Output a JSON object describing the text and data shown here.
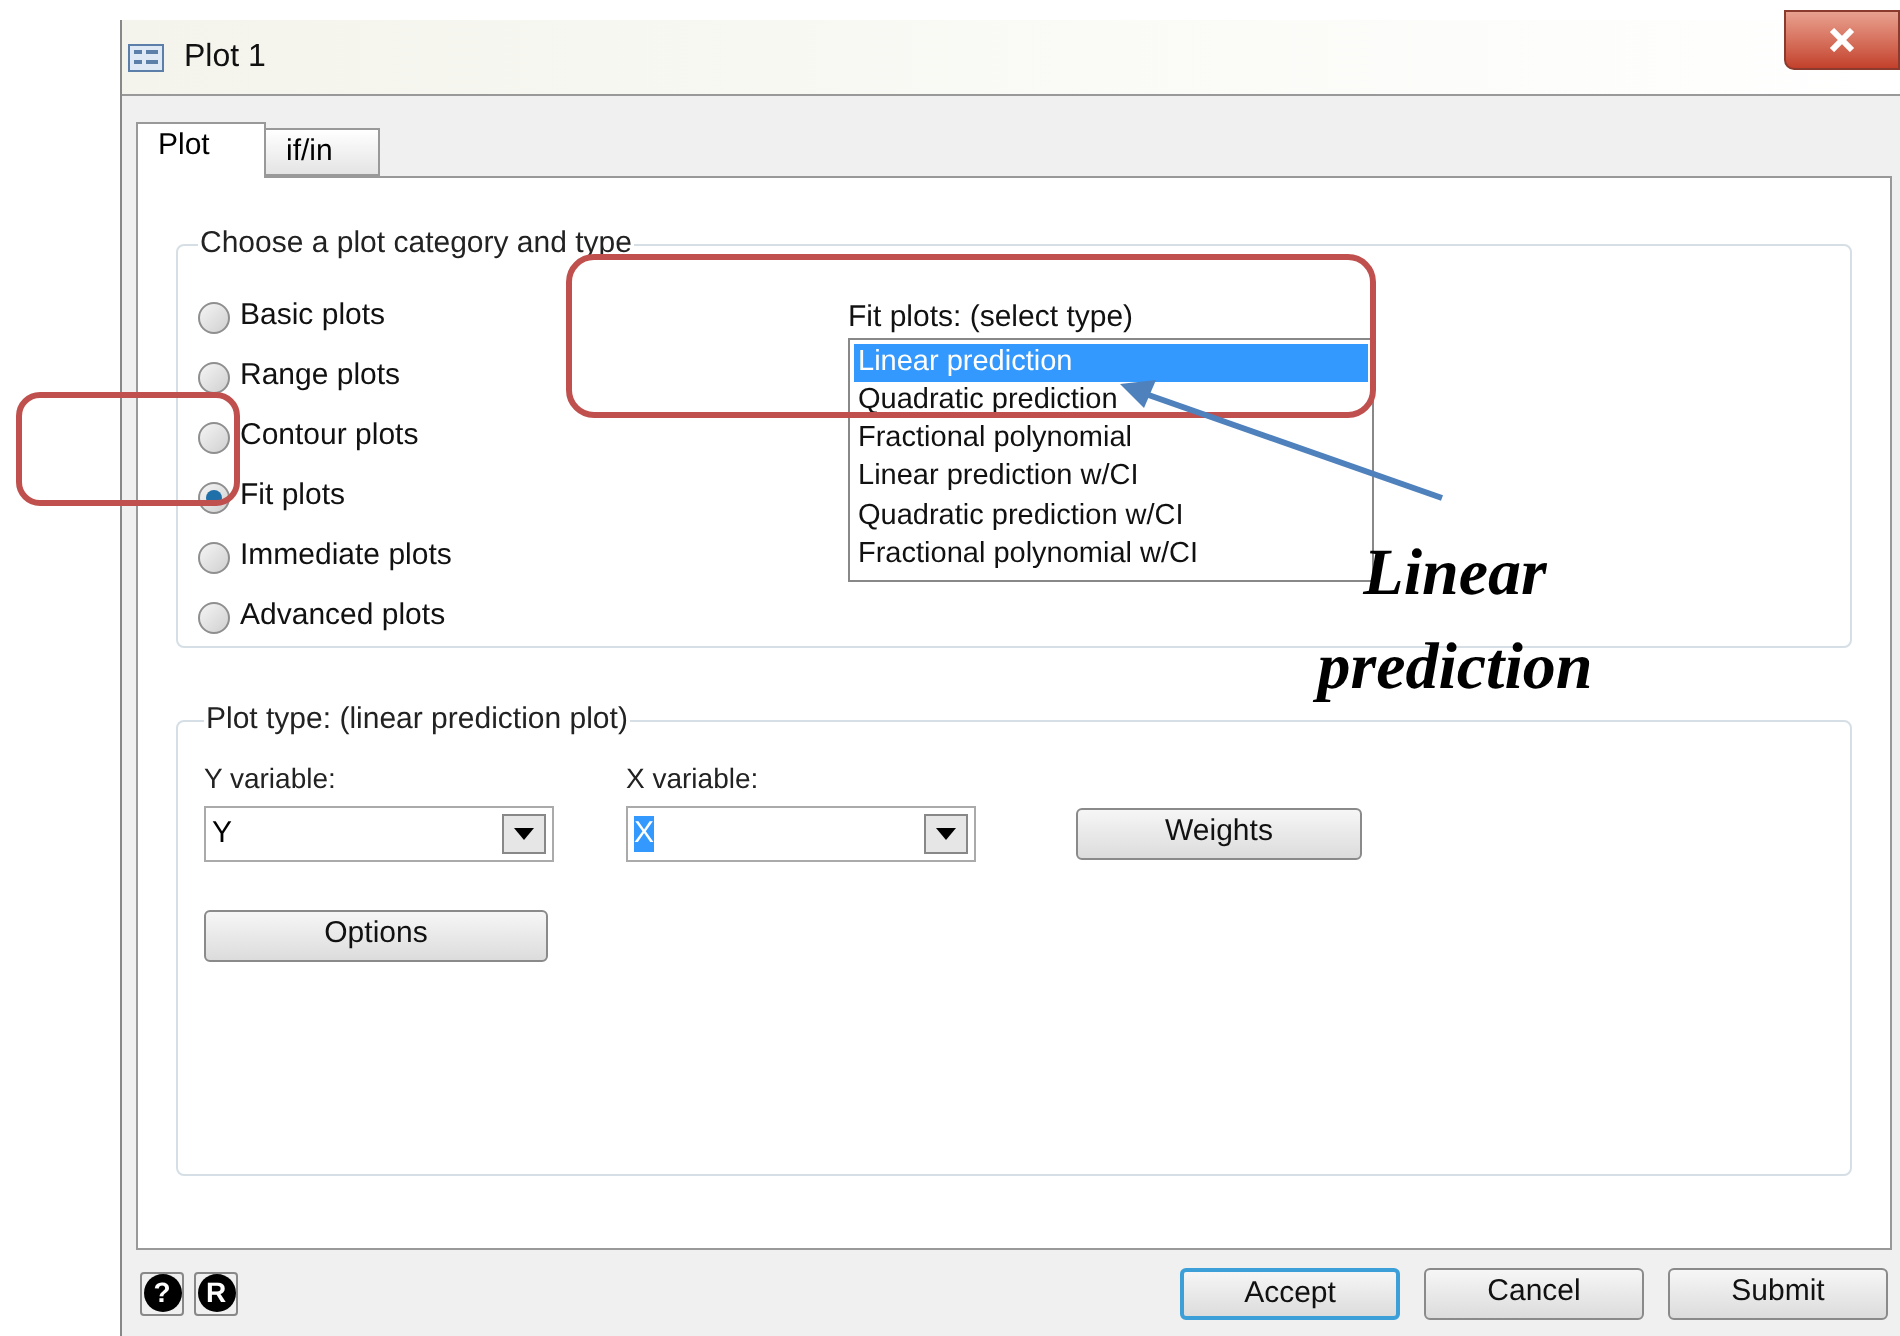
{
  "window": {
    "title": "Plot 1"
  },
  "tabs": [
    {
      "label": "Plot",
      "selected": true
    },
    {
      "label": "if/in",
      "selected": false
    }
  ],
  "category_group": {
    "title": "Choose a plot category and type",
    "options": [
      {
        "label": "Basic plots",
        "selected": false
      },
      {
        "label": "Range plots",
        "selected": false
      },
      {
        "label": "Contour plots",
        "selected": false
      },
      {
        "label": "Fit plots",
        "selected": true
      },
      {
        "label": "Immediate plots",
        "selected": false
      },
      {
        "label": "Advanced plots",
        "selected": false
      }
    ]
  },
  "fit_plots": {
    "label": "Fit plots: (select type)",
    "items": [
      {
        "label": "Linear prediction",
        "selected": true
      },
      {
        "label": "Quadratic prediction",
        "selected": false
      },
      {
        "label": "Fractional polynomial",
        "selected": false
      },
      {
        "label": "Linear prediction w/CI",
        "selected": false
      },
      {
        "label": "Quadratic prediction w/CI",
        "selected": false
      },
      {
        "label": "Fractional polynomial w/CI",
        "selected": false
      }
    ]
  },
  "plot_type_group": {
    "title": "Plot type: (linear prediction plot)",
    "y_variable": {
      "label": "Y variable:",
      "value": "Y",
      "highlighted": false
    },
    "x_variable": {
      "label": "X variable:",
      "value": "X",
      "highlighted": true
    },
    "weights_button": "Weights",
    "options_button": "Options"
  },
  "footer": {
    "icon_buttons": [
      "?",
      "R"
    ],
    "buttons": [
      {
        "label": "Accept",
        "default": true
      },
      {
        "label": "Cancel",
        "default": false
      },
      {
        "label": "Submit",
        "default": false
      }
    ]
  },
  "annotation": {
    "text": "Linear prediction"
  }
}
